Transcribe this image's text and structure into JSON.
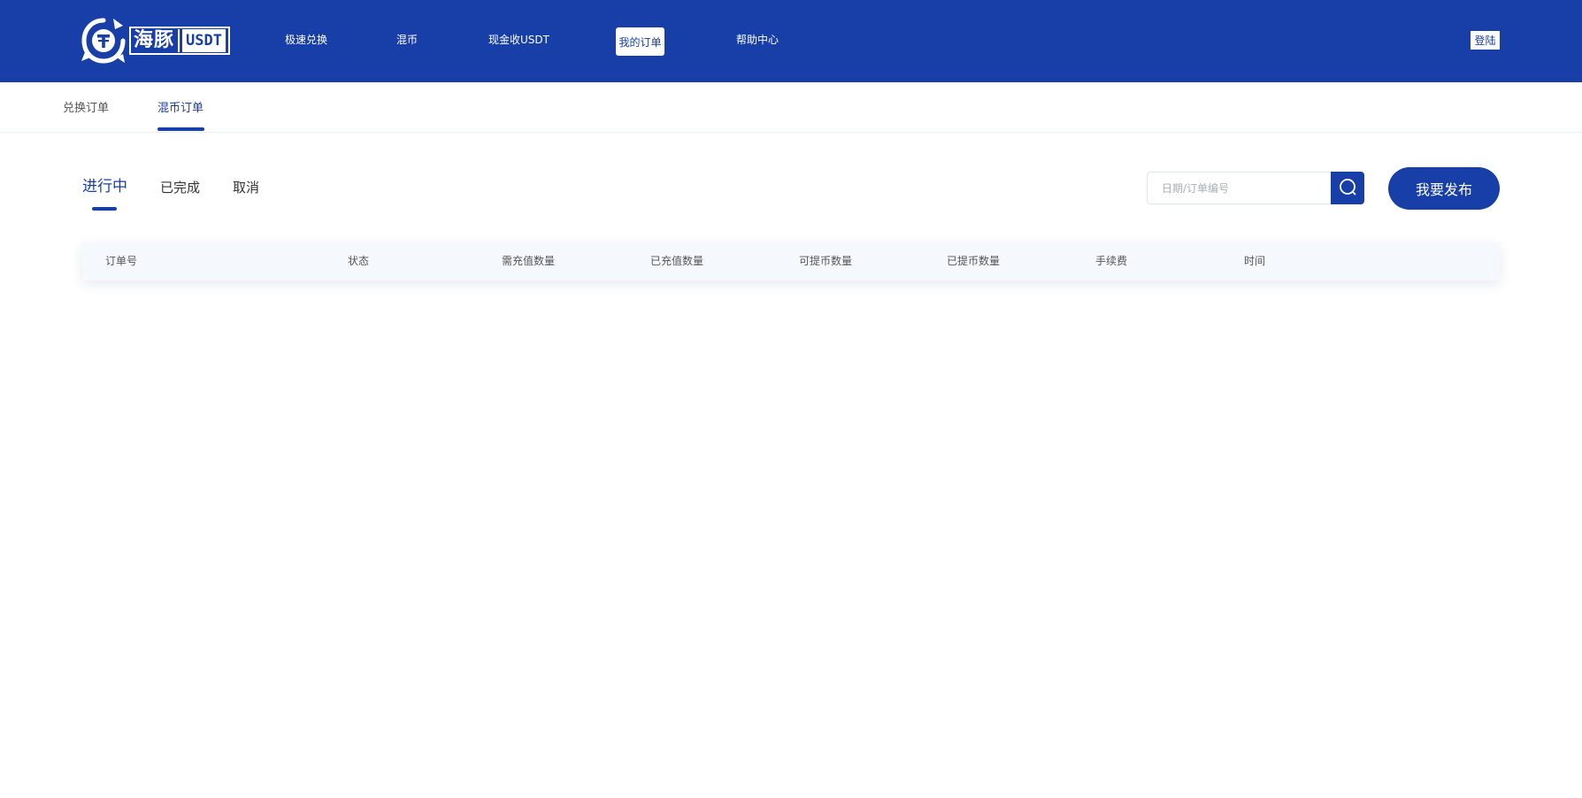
{
  "brand": {
    "name_cn": "海豚",
    "name_en": "USDT",
    "color": "#183fa8"
  },
  "nav": {
    "items": [
      {
        "label": "极速兑换"
      },
      {
        "label": "混币"
      },
      {
        "label": "现金收USDT"
      },
      {
        "label": "我的订单",
        "active": true
      },
      {
        "label": "帮助中心"
      }
    ],
    "login_label": "登陆"
  },
  "subtabs": [
    {
      "label": "兑换订单",
      "active": false
    },
    {
      "label": "混币订单",
      "active": true
    }
  ],
  "status_tabs": [
    {
      "label": "进行中",
      "active": true
    },
    {
      "label": "已完成",
      "active": false
    },
    {
      "label": "取消",
      "active": false
    }
  ],
  "search": {
    "placeholder": "日期/订单编号",
    "value": "",
    "icon": "search-icon"
  },
  "publish_label": "我要发布",
  "table": {
    "columns": [
      "订单号",
      "状态",
      "需充值数量",
      "已充值数量",
      "可提币数量",
      "已提币数量",
      "手续费",
      "时间"
    ],
    "rows": []
  }
}
